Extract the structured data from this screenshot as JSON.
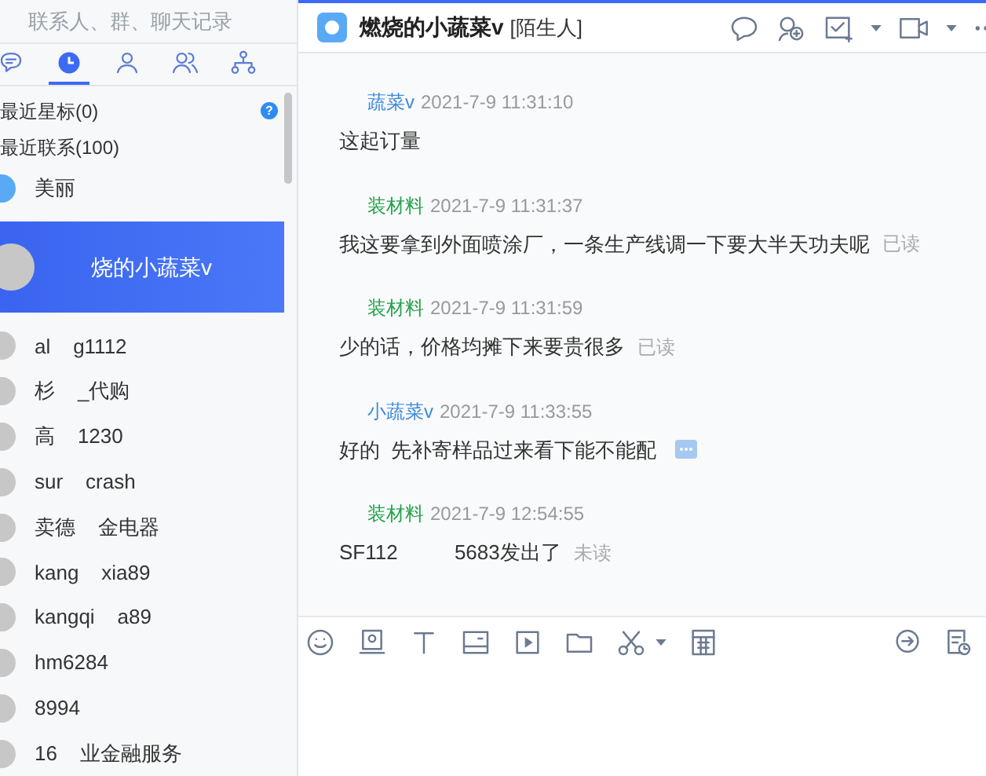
{
  "search": {
    "placeholder": "联系人、群、聊天记录"
  },
  "nav_tabs": [
    {
      "kind": "chat",
      "selected": false
    },
    {
      "kind": "clock",
      "selected": true
    },
    {
      "kind": "person",
      "selected": false
    },
    {
      "kind": "group",
      "selected": false
    },
    {
      "kind": "org",
      "selected": false
    }
  ],
  "sections": [
    {
      "label": "最近星标(0)",
      "help": "?"
    },
    {
      "label": "最近联系(100)"
    }
  ],
  "contacts": [
    {
      "name": "美丽",
      "selected": false,
      "color": "#5aa9f5"
    },
    {
      "name": "烧的小蔬菜v",
      "selected": true,
      "color": "#c7c7c7"
    },
    {
      "name": "al    g1112",
      "selected": false,
      "color": "#c7c7c7"
    },
    {
      "name": "杉    _代购",
      "selected": false,
      "color": "#c7c7c7"
    },
    {
      "name": "高    1230",
      "selected": false,
      "color": "#c7c7c7"
    },
    {
      "name": "sur    crash",
      "selected": false,
      "color": "#c7c7c7"
    },
    {
      "name": "卖德    金电器",
      "selected": false,
      "color": "#c7c7c7"
    },
    {
      "name": "kang    xia89",
      "selected": false,
      "color": "#c7c7c7"
    },
    {
      "name": "kangqi    a89",
      "selected": false,
      "color": "#c7c7c7"
    },
    {
      "name": "hm6284",
      "selected": false,
      "color": "#c7c7c7"
    },
    {
      "name": "8994",
      "selected": false,
      "color": "#c7c7c7"
    },
    {
      "name": "16    业金融服务",
      "selected": false,
      "color": "#c7c7c7"
    }
  ],
  "chat": {
    "title": "燃烧的小蔬菜v",
    "tag": "[陌生人]",
    "messages": [
      {
        "sender": "蔬菜v",
        "color": "#3d8ae0",
        "time": "2021-7-9 11:31:10",
        "text": "这起订量"
      },
      {
        "sender": "装材料",
        "color": "#22a34a",
        "time": "2021-7-9 11:31:37",
        "text": "我这要拿到外面喷涂厂，一条生产线调一下要大半天功夫呢",
        "status": "已读"
      },
      {
        "sender": "装材料",
        "color": "#22a34a",
        "time": "2021-7-9 11:31:59",
        "text": "少的话，价格均摊下来要贵很多",
        "status": "已读"
      },
      {
        "sender": "小蔬菜v",
        "color": "#3d8ae0",
        "time": "2021-7-9 11:33:55",
        "text": "好的  先补寄样品过来看下能不能配",
        "kind": "more"
      },
      {
        "sender": "装材料",
        "color": "#22a34a",
        "time": "2021-7-9 12:54:55",
        "text": "SF112          5683发出了",
        "status": "未读"
      }
    ]
  }
}
